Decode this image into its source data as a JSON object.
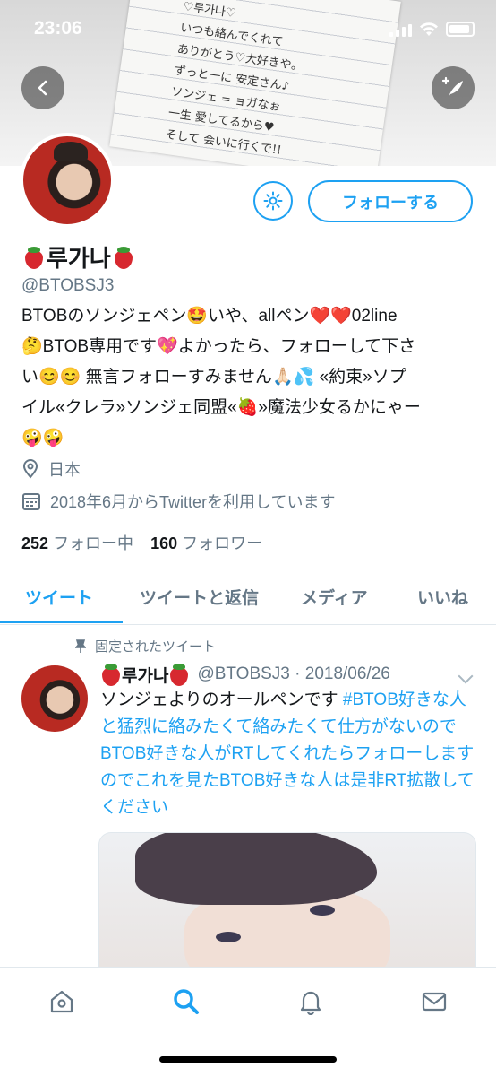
{
  "status_bar": {
    "time": "23:06"
  },
  "header_note": {
    "lines": [
      "♡루가나♡",
      "いつも絡んでくれて",
      "ありがとう♡大好きや。",
      "ずっと一に 安定さん♪",
      "ソンジェ = ョガなぉ",
      "一生 愛してるから♥",
      "そして 会いに行くで!!"
    ]
  },
  "buttons": {
    "follow_label": "フォローする"
  },
  "profile": {
    "name": "루가나",
    "handle": "@BTOBSJ3",
    "bio_lines": [
      "BTOBのソンジェペン🤩いや、allペン❤️❤️02line",
      "🤔BTOB専用です💖よかったら、フォローして下さ",
      "い😊😊 無言フォローすみません🙏🏻💦 «約束»ソプ",
      "イル«クレラ»ソンジェ同盟«🍓»魔法少女るかにゃー",
      "🤪🤪"
    ],
    "location": "日本",
    "joined": "2018年6月からTwitterを利用しています",
    "following_count": "252",
    "following_label": "フォロー中",
    "followers_count": "160",
    "followers_label": "フォロワー"
  },
  "tabs": [
    {
      "label": "ツイート",
      "active": true
    },
    {
      "label": "ツイートと返信",
      "active": false
    },
    {
      "label": "メディア",
      "active": false
    },
    {
      "label": "いいね",
      "active": false
    }
  ],
  "pinned_tweet": {
    "pinned_label": "固定されたツイート",
    "author_name": "루가나",
    "author_handle_date": "@BTOBSJ3 · 2018/06/26",
    "text_before": "ソンジェよりのオールペンです ",
    "hashtag": "#BTOB好きな人と猛烈に絡みたくて絡みたくて仕方がないのでBTOB好きな人がRTしてくれたらフォローしますのでこれを見たBTOB好きな人は是非RT拡散してください"
  },
  "bottom_nav": [
    {
      "icon": "home-icon",
      "active": false
    },
    {
      "icon": "search-icon",
      "active": true
    },
    {
      "icon": "notifications-icon",
      "active": false
    },
    {
      "icon": "messages-icon",
      "active": false
    }
  ],
  "colors": {
    "accent": "#1da1f2",
    "secondary_text": "#657786"
  }
}
